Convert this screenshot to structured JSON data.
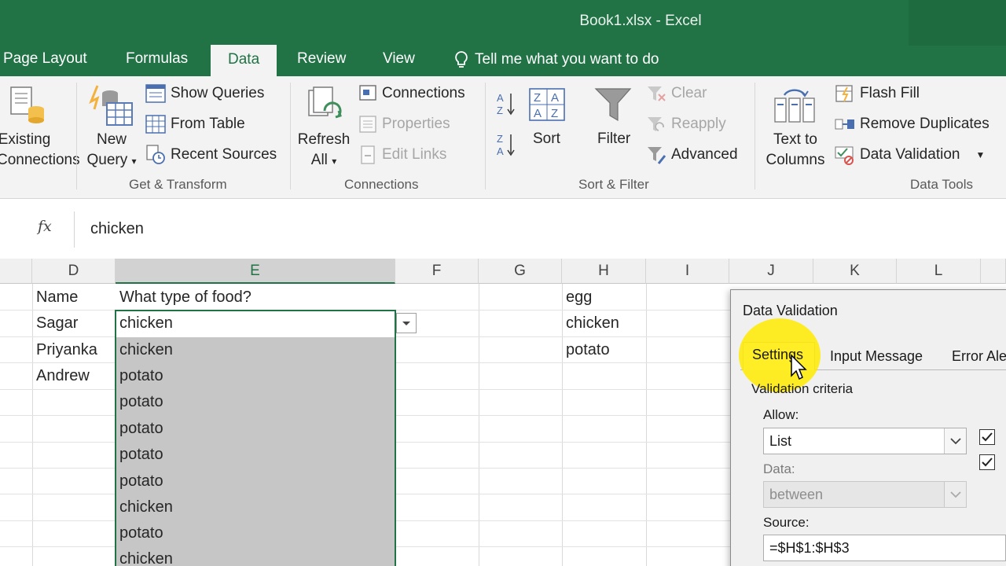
{
  "window": {
    "title": "Book1.xlsx - Excel"
  },
  "tabs": [
    "Page Layout",
    "Formulas",
    "Data",
    "Review",
    "View"
  ],
  "tell_me": "Tell me what you want to do",
  "ribbon": {
    "existing_connections": [
      "Existing",
      "Connections"
    ],
    "new_query": [
      "New",
      "Query"
    ],
    "show_queries": "Show Queries",
    "from_table": "From Table",
    "recent_sources": "Recent Sources",
    "get_transform": "Get & Transform",
    "refresh_all": [
      "Refresh",
      "All"
    ],
    "connections": "Connections",
    "properties": "Properties",
    "edit_links": "Edit Links",
    "connections_group": "Connections",
    "sort": "Sort",
    "filter": "Filter",
    "clear": "Clear",
    "reapply": "Reapply",
    "advanced": "Advanced",
    "sort_filter": "Sort & Filter",
    "text_to_columns": [
      "Text to",
      "Columns"
    ],
    "flash_fill": "Flash Fill",
    "remove_duplicates": "Remove Duplicates",
    "data_validation": "Data Validation",
    "data_tools": "Data Tools"
  },
  "formula_bar": {
    "fx": "fx",
    "value": "chicken"
  },
  "columns": [
    "D",
    "E",
    "F",
    "G",
    "H",
    "I",
    "J",
    "K",
    "L"
  ],
  "sheet": {
    "names": [
      "Name",
      "Sagar",
      "Priyanka",
      "Andrew"
    ],
    "food_header": "What type of food?",
    "food": [
      "chicken",
      "chicken",
      "potato",
      "potato",
      "potato",
      "potato",
      "potato",
      "chicken",
      "potato",
      "chicken"
    ],
    "list": [
      "egg",
      "chicken",
      "potato"
    ]
  },
  "dialog": {
    "title": "Data Validation",
    "tabs": [
      "Settings",
      "Input Message",
      "Error Ale"
    ],
    "criteria_label": "Validation criteria",
    "allow_label": "Allow:",
    "allow_value": "List",
    "data_label": "Data:",
    "data_value": "between",
    "source_label": "Source:",
    "source_value": "=$H$1:$H$3"
  }
}
